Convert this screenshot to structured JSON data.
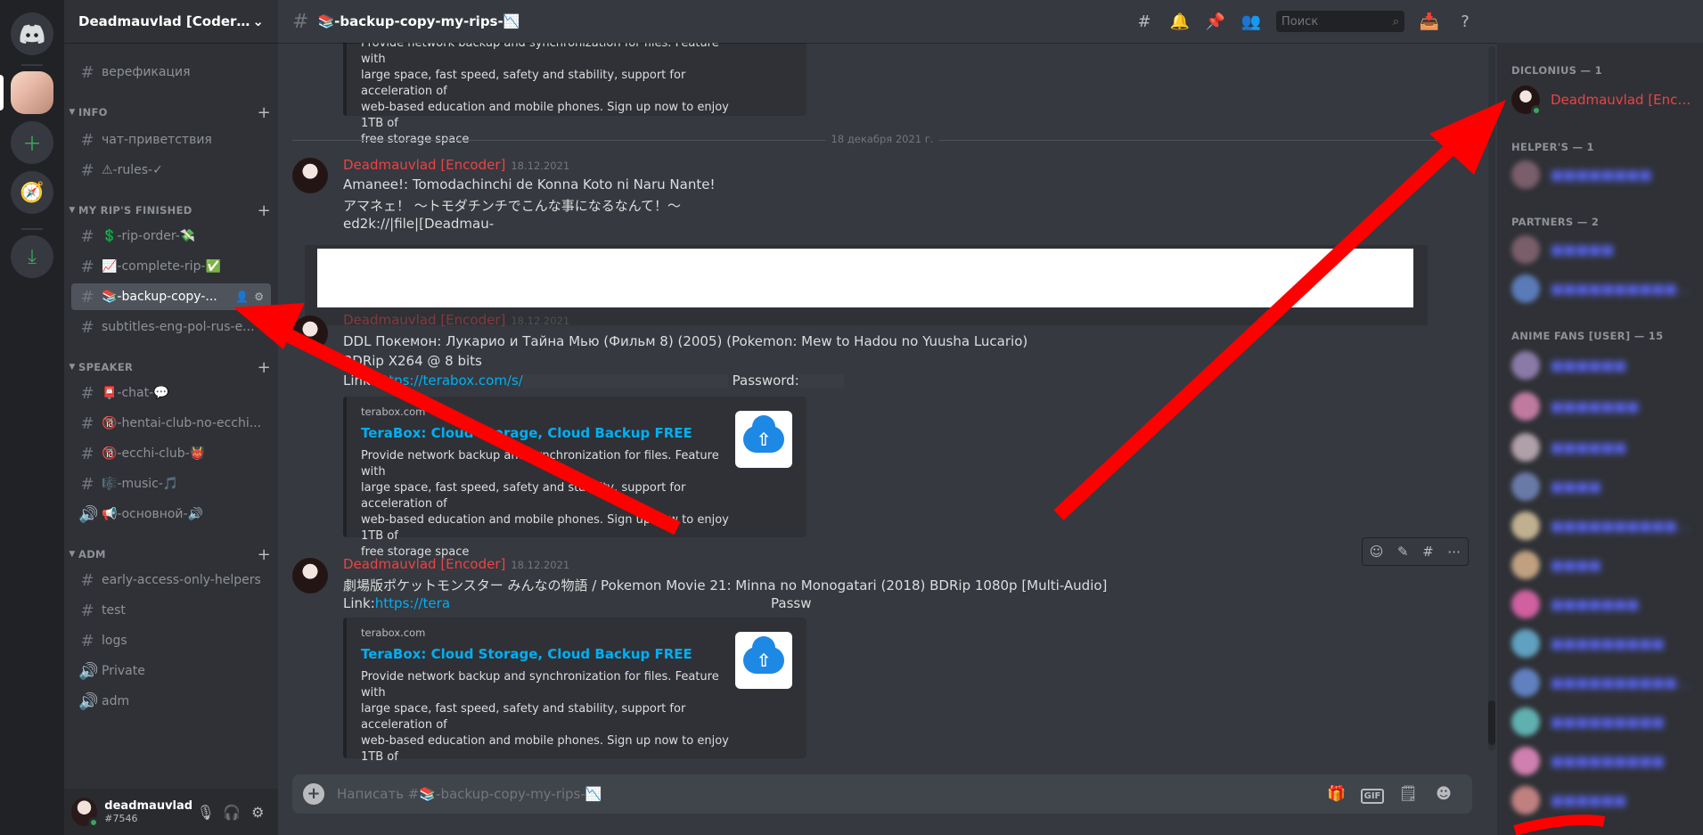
{
  "server": {
    "name": "Deadmauvlad [Coder] Y..."
  },
  "channels": {
    "top": [
      {
        "name": "верефикация"
      }
    ],
    "categories": [
      {
        "name": "INFO",
        "channels": [
          "чат-приветствия",
          "⚠-rules-✓"
        ]
      },
      {
        "name": "MY RIP'S FINISHED",
        "channels": [
          "💲-rip-order-💸",
          "📈-complete-rip-✅",
          "📚-backup-copy-...",
          "subtitles-eng-pol-rus-e..."
        ]
      },
      {
        "name": "SPEAKER",
        "channels": [
          "📮-chat-💬",
          "🔞-hentai-club-no-ecchi...",
          "🔞-ecchi-club-👹",
          "🎼-music-🎵",
          "📢-основной-🔊"
        ]
      },
      {
        "name": "ADM",
        "channels": [
          "early-access-only-helpers",
          "test",
          "logs",
          "Private",
          "adm"
        ]
      }
    ]
  },
  "user": {
    "name": "deadmauvlad",
    "tag": "#7546"
  },
  "chat": {
    "channel_title": "📚-backup-copy-my-rips-📉",
    "search_placeholder": "Поиск",
    "composer_placeholder": "Написать #📚-backup-copy-my-rips-📉",
    "date_divider": "18 декабря 2021 г.",
    "embed": {
      "provider": "terabox.com",
      "title": "TeraBox: Cloud Storage, Cloud Backup FREE",
      "desc_lines": [
        "Provide network backup and synchronization for files. Feature with",
        "large space, fast speed, safety and stability, support for acceleration of",
        "web-based education and mobile phones. Sign up now to enjoy 1TB of",
        "free storage space"
      ]
    },
    "messages": [
      {
        "author": "Deadmauvlad [Encoder]",
        "time": "18.12.2021",
        "lines": [
          "Amanee!: Tomodachinchi de Konna Koto ni Naru Nante!",
          "アマネェ！ 〜トモダチンチでこんな事になるなんて！〜",
          "ed2k://|file|[Deadmau-"
        ]
      },
      {
        "author": "Deadmauvlad [Encoder]",
        "time": "18.12.2021",
        "lines": [
          "DDL Покемон: Лукарио и Тайна Мью (Фильм 8) (2005) (Pokemon: Mew to Hadou no Yuusha Lucario)",
          "BDRip X264 @ 8 bits"
        ],
        "link_prefix": "Link:",
        "link_text": "https://terabox.com/s/",
        "password_label": "Password:"
      },
      {
        "author": "Deadmauvlad [Encoder]",
        "time": "18.12.2021",
        "lines": [
          "劇場版ポケットモンスター みんなの物語 / Pokemon Movie 21: Minna no Monogatari (2018) BDRip 1080p [Multi-Audio]"
        ],
        "link_prefix": "Link:",
        "link_text": "https://tera",
        "password_label": "Passw"
      }
    ]
  },
  "members": {
    "groups": [
      {
        "label": "DICLONIUS — 1",
        "members": [
          "Deadmauvlad [Encoder]"
        ]
      },
      {
        "label": "HELPER'S — 1"
      },
      {
        "label": "PARTNERS — 2"
      },
      {
        "label": "ANIME FANS [USER] — 15"
      }
    ]
  },
  "colors": {
    "rail": "#202225",
    "sidebar": "#2f3136",
    "chat": "#36393f",
    "author": "#ed4245",
    "link": "#00aff4",
    "arrow": "#ff0000",
    "online": "#3ba55d"
  }
}
